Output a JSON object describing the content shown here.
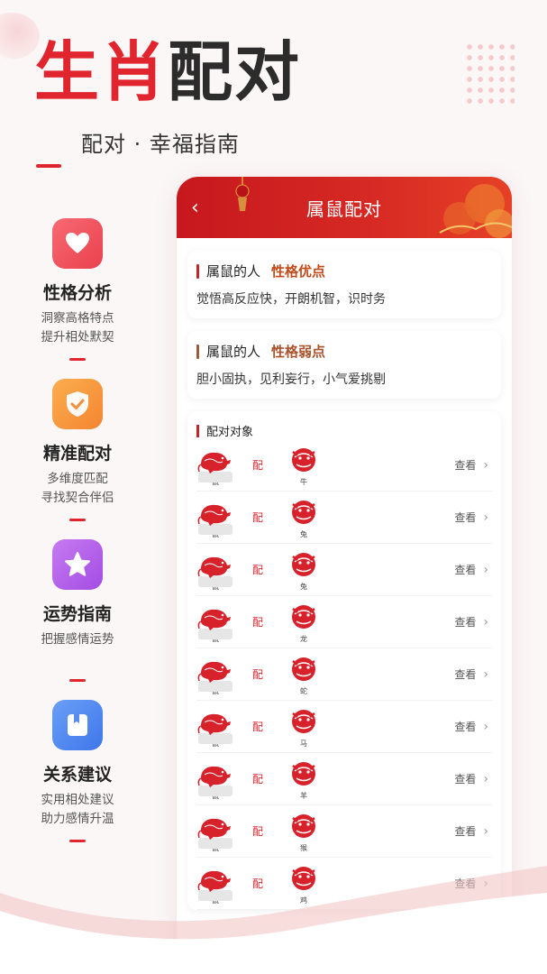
{
  "hero": {
    "title_red": "生肖",
    "title_dark": "配对",
    "subtitle": "配对 · 幸福指南"
  },
  "features": [
    {
      "icon": "heart-icon",
      "color": "#f0535f",
      "title": "性格分析",
      "desc1": "洞察高格特点",
      "desc2": "提升相处默契"
    },
    {
      "icon": "shield-check-icon",
      "color": "#f7983e",
      "title": "精准配对",
      "desc1": "多维度匹配",
      "desc2": "寻找契合伴侣"
    },
    {
      "icon": "star-icon",
      "color": "#b560ea",
      "title": "运势指南",
      "desc1": "把握感情运势",
      "desc2": ""
    },
    {
      "icon": "book-icon",
      "color": "#4f86f0",
      "title": "关系建议",
      "desc1": "实用相处建议",
      "desc2": "助力感情升温"
    }
  ],
  "phone": {
    "header_title": "属鼠配对",
    "strengths": {
      "prefix": "属鼠的人",
      "label": "性格优点",
      "text": "觉悟高反应快，开朗机智，识时务"
    },
    "weaknesses": {
      "prefix": "属鼠的人",
      "label": "性格弱点",
      "text": "胆小固执，见利妄行，小气爱挑剔"
    },
    "match_title": "配对对象",
    "pair_label": "配",
    "view_label": "查看",
    "rows": [
      {
        "left": "鼠",
        "right": "牛"
      },
      {
        "left": "鼠",
        "right": "兔"
      },
      {
        "left": "鼠",
        "right": "兔"
      },
      {
        "left": "鼠",
        "right": "龙"
      },
      {
        "left": "鼠",
        "right": "蛇"
      },
      {
        "left": "鼠",
        "right": "马"
      },
      {
        "left": "鼠",
        "right": "羊"
      },
      {
        "left": "鼠",
        "right": "猴"
      },
      {
        "left": "鼠",
        "right": "鸡"
      }
    ]
  },
  "colors": {
    "brand_red": "#e1252f"
  }
}
